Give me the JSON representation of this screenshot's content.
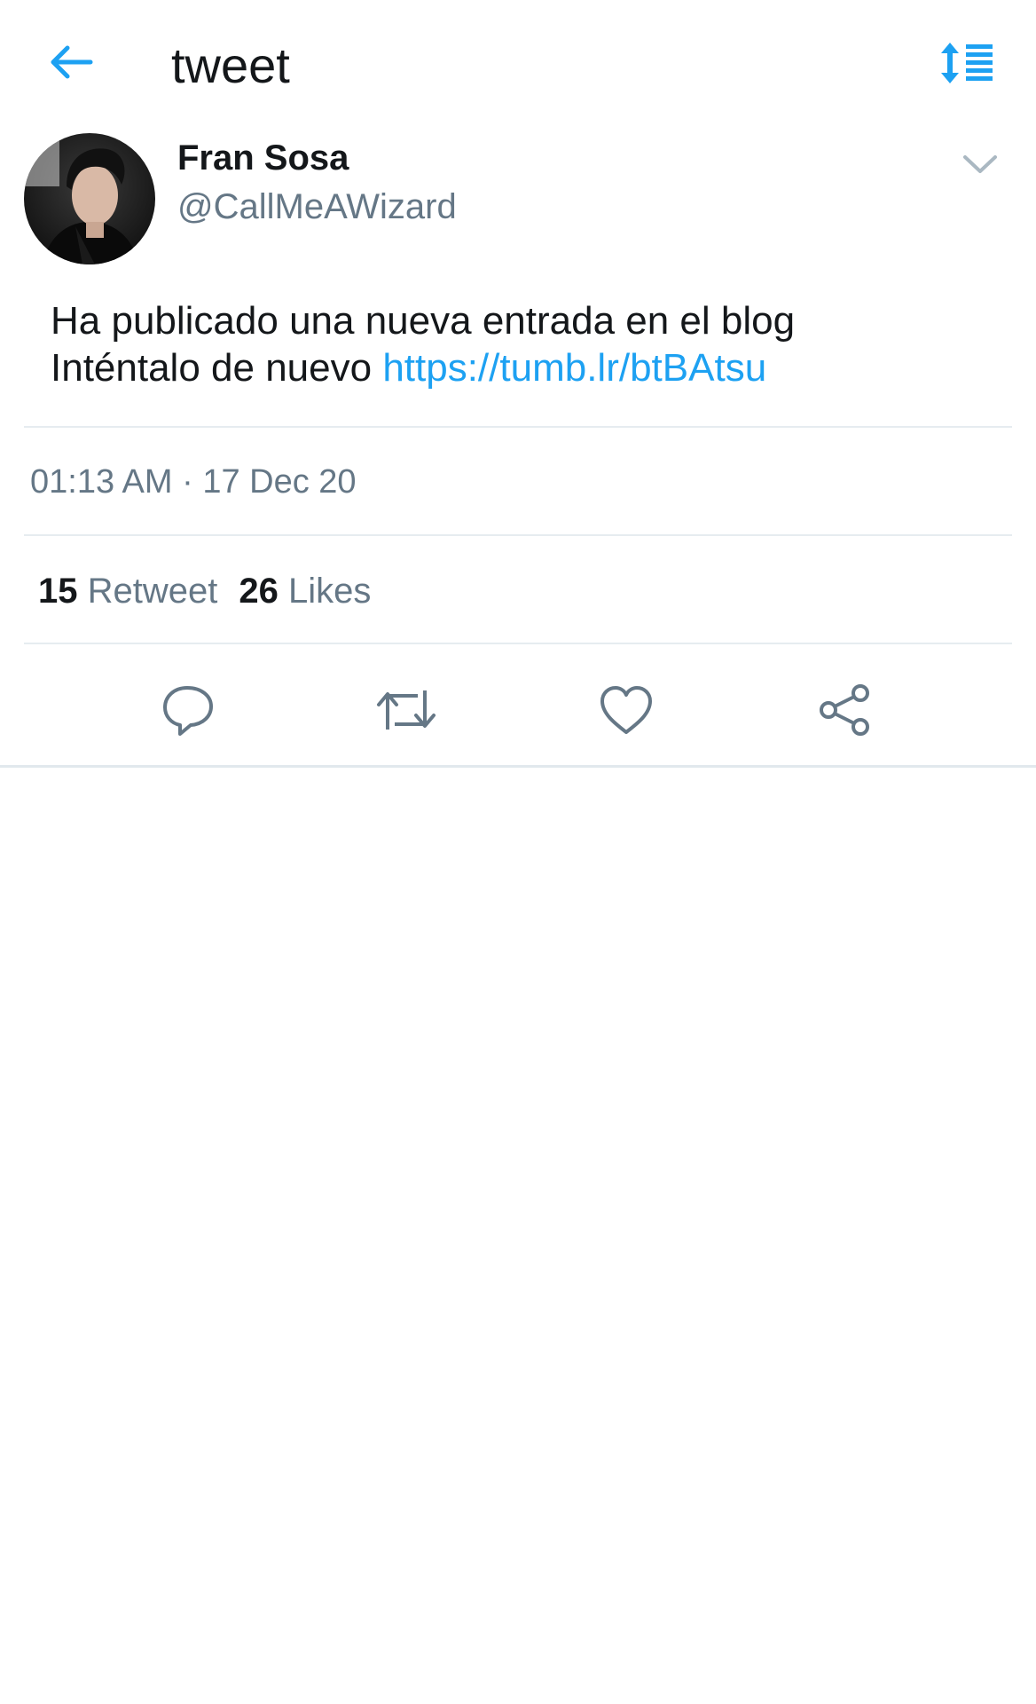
{
  "header": {
    "title": "tweet",
    "back_icon": "arrow-left-icon",
    "sort_icon": "sort-list-icon",
    "accent_color": "#1da1f2"
  },
  "tweet": {
    "author_name": "Fran Sosa",
    "author_handle": "@CallMeAWizard",
    "text_line1": "Ha publicado una nueva entrada en el blog",
    "text_line2_prefix": "Inténtalo de nuevo",
    "link": "https://tumb.lr/btBAtsu",
    "timestamp": "01:13 AM · 17 Dec 20",
    "retweet_count": "15",
    "retweet_label": "Retweet",
    "like_count": "26",
    "like_label": "Likes"
  },
  "actions": [
    {
      "icon": "reply-icon"
    },
    {
      "icon": "retweet-icon"
    },
    {
      "icon": "like-heart-icon"
    },
    {
      "icon": "share-icon"
    }
  ],
  "colors": {
    "text_primary": "#14171a",
    "text_secondary": "#657786",
    "link": "#1da1f2",
    "divider": "#e6ecf0"
  }
}
